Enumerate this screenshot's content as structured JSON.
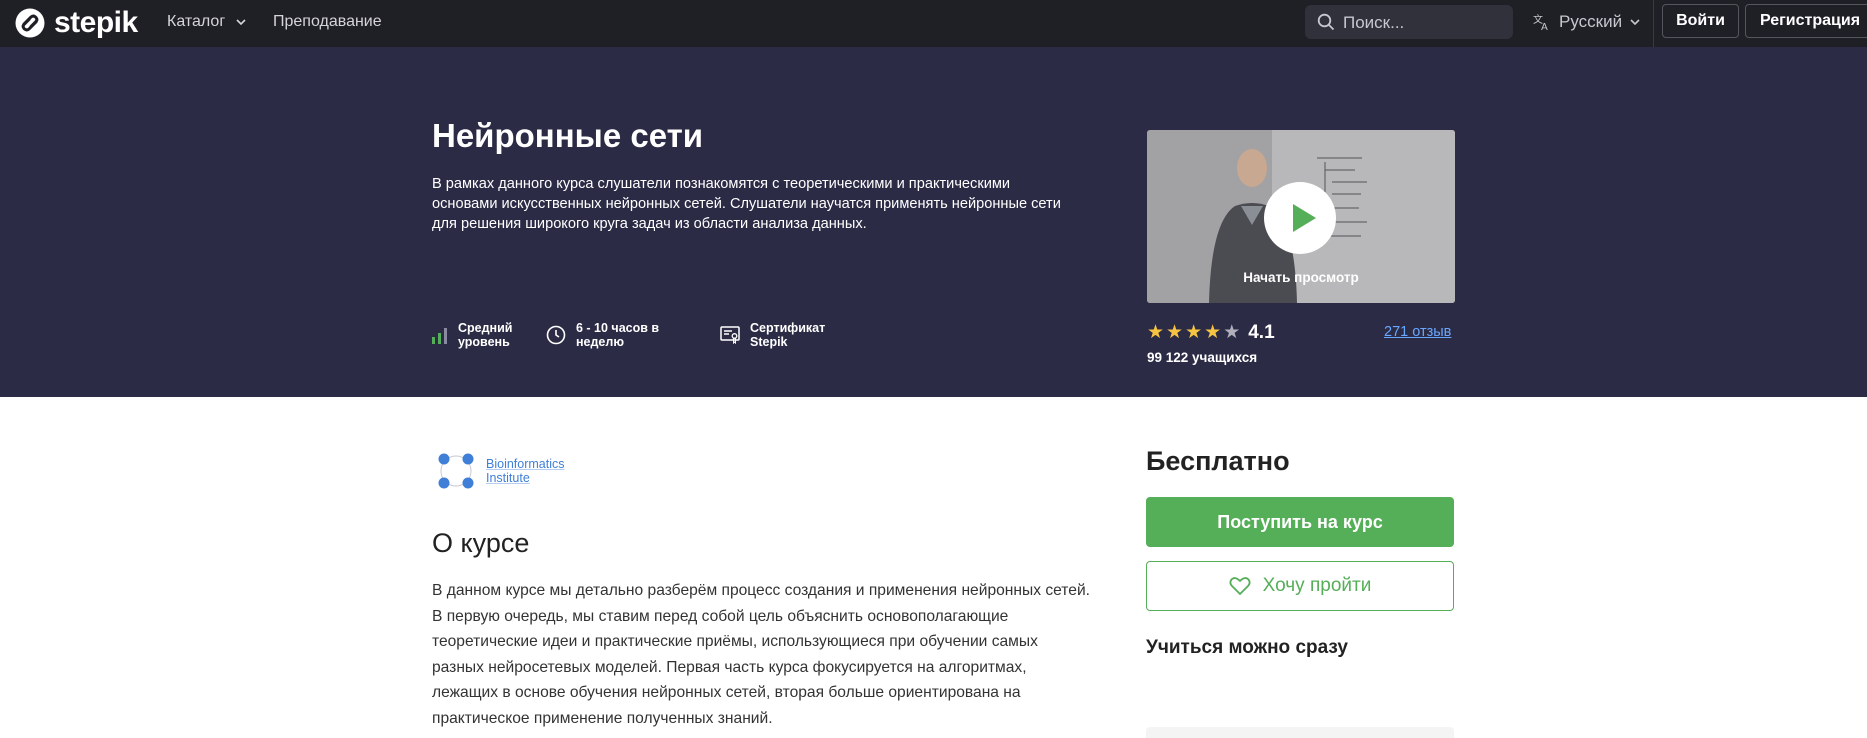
{
  "topnav": {
    "brand": "stepik",
    "catalog": "Каталог",
    "teaching": "Преподавание",
    "search_placeholder": "Поиск...",
    "language": "Русский",
    "login": "Войти",
    "register": "Регистрация"
  },
  "course": {
    "title": "Нейронные сети",
    "description": "В рамках данного курса слушатели познакомятся с теоретическими и практическими основами искусственных нейронных сетей. Слушатели научатся применять нейронные сети для решения широкого круга задач из области анализа данных.",
    "stats": {
      "level_line1": "Средний",
      "level_line2": "уровень",
      "hours_line1": "6 - 10 часов в",
      "hours_line2": "неделю",
      "cert_line1": "Сертификат",
      "cert_line2": "Stepik"
    },
    "video_label": "Начать просмотр",
    "rating": "4.1",
    "rating_stars": 4,
    "reviews": "271 отзыв",
    "students": "99 122 учащихся"
  },
  "org": {
    "line1": "Bioinformatics",
    "line2": "Institute"
  },
  "about": {
    "heading": "О курсе",
    "text": "В данном курсе мы детально разберём процесс создания и применения нейронных сетей. В первую очередь, мы ставим перед собой цель объяснить основополагающие теоретические идеи и практические приёмы, использующиеся при обучении самых разных нейросетевых моделей. Первая часть курса фокусируется на алгоритмах, лежащих в основе обучения нейронных сетей, вторая больше ориентирована на практическое применение полученных знаний."
  },
  "sidebar": {
    "price": "Бесплатно",
    "enroll": "Поступить на курс",
    "wishlist": "Хочу пройти",
    "start_now": "Учиться можно сразу"
  },
  "icons": {
    "logo": "stepik-logo-icon",
    "catalog_chevron": "chevron-down-icon",
    "search": "search-icon",
    "language": "translate-icon",
    "level": "signal-bars-icon",
    "hours": "clock-icon",
    "certificate": "certificate-icon",
    "play": "play-icon",
    "star": "star-icon",
    "org": "bioinformatics-logo-icon",
    "wish": "heart-icon"
  },
  "colors": {
    "topbar": "#1f1f26",
    "hero": "#2b2b46",
    "accent_green": "#55ae58",
    "star_gold": "#f6c342",
    "link_blue": "#6aa7ff"
  }
}
